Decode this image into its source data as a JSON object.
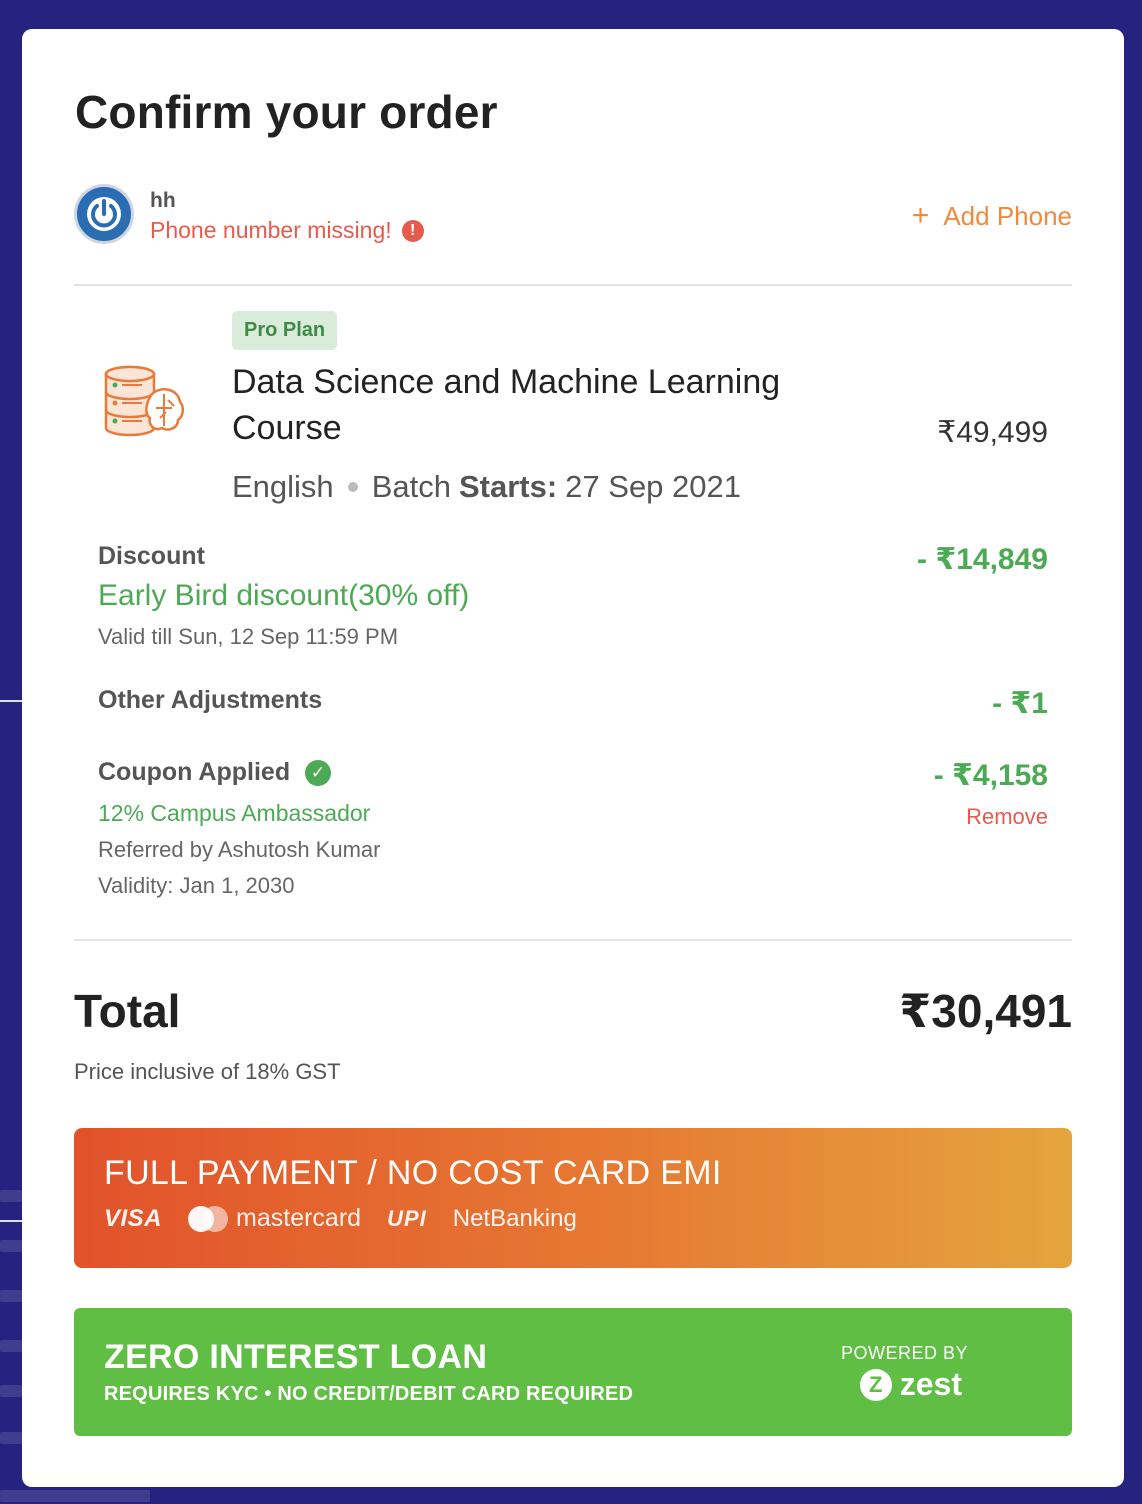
{
  "header": {
    "title": "Confirm your order"
  },
  "user": {
    "name": "hh",
    "warning": "Phone number missing!",
    "add_phone_label": "Add Phone"
  },
  "course": {
    "plan_badge": "Pro Plan",
    "title": "Data Science and Machine Learning Course",
    "price": "₹49,499",
    "language": "English",
    "batch_prefix": "Batch",
    "starts_label": "Starts:",
    "start_date": "27 Sep 2021"
  },
  "discount": {
    "label": "Discount",
    "name": "Early Bird discount(30% off)",
    "validity": "Valid till Sun, 12 Sep 11:59 PM",
    "amount": "- ₹14,849"
  },
  "adjustments": {
    "label": "Other Adjustments",
    "amount": "- ₹1"
  },
  "coupon": {
    "label": "Coupon Applied",
    "name": "12% Campus Ambassador",
    "referred_by": "Referred by Ashutosh Kumar",
    "validity": "Validity: Jan 1, 2030",
    "amount": "- ₹4,158",
    "remove_label": "Remove"
  },
  "total": {
    "label": "Total",
    "amount": "₹30,491",
    "note": "Price inclusive of 18% GST"
  },
  "full_payment": {
    "title": "FULL PAYMENT / NO COST CARD EMI",
    "visa": "VISA",
    "mastercard": "mastercard",
    "upi": "UPI",
    "netbanking": "NetBanking"
  },
  "loan": {
    "title": "ZERO INTEREST LOAN",
    "subtitle": "REQUIRES KYC • NO CREDIT/DEBIT CARD REQUIRED",
    "powered_by": "POWERED BY",
    "brand": "zest"
  },
  "colors": {
    "background": "#262380",
    "accent_orange": "#ef8a3e",
    "error_red": "#e55b4d",
    "discount_green": "#4caa55",
    "loan_green": "#5fbe43"
  }
}
